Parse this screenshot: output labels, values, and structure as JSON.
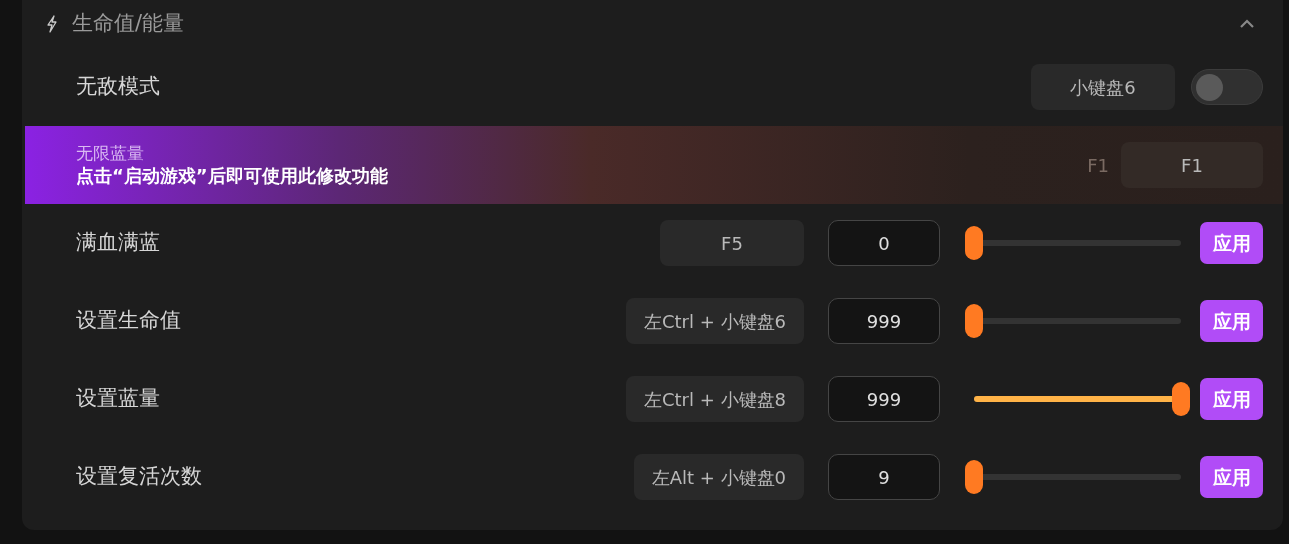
{
  "section": {
    "title": "生命值/能量",
    "expanded": true
  },
  "items": [
    {
      "kind": "toggle",
      "label": "无敌模式",
      "hotkey": "小键盘6",
      "on": false
    },
    {
      "kind": "banner",
      "label": "无限蓝量",
      "message": "点击“启动游戏”后即可使用此修改功能",
      "ghost_hotkey": "F1",
      "hotkey": "F1"
    },
    {
      "kind": "slider",
      "label": "满血满蓝",
      "hotkey": "F5",
      "value": "0",
      "level": 0,
      "button": "应用"
    },
    {
      "kind": "slider",
      "label": "设置生命值",
      "hotkey": "左Ctrl + 小键盘6",
      "value": "999",
      "level": 0,
      "button": "应用"
    },
    {
      "kind": "slider",
      "label": "设置蓝量",
      "hotkey": "左Ctrl + 小键盘8",
      "value": "999",
      "level": 1,
      "button": "应用"
    },
    {
      "kind": "slider",
      "label": "设置复活次数",
      "hotkey": "左Alt + 小键盘0",
      "value": "9",
      "level": 0,
      "button": "应用"
    }
  ]
}
